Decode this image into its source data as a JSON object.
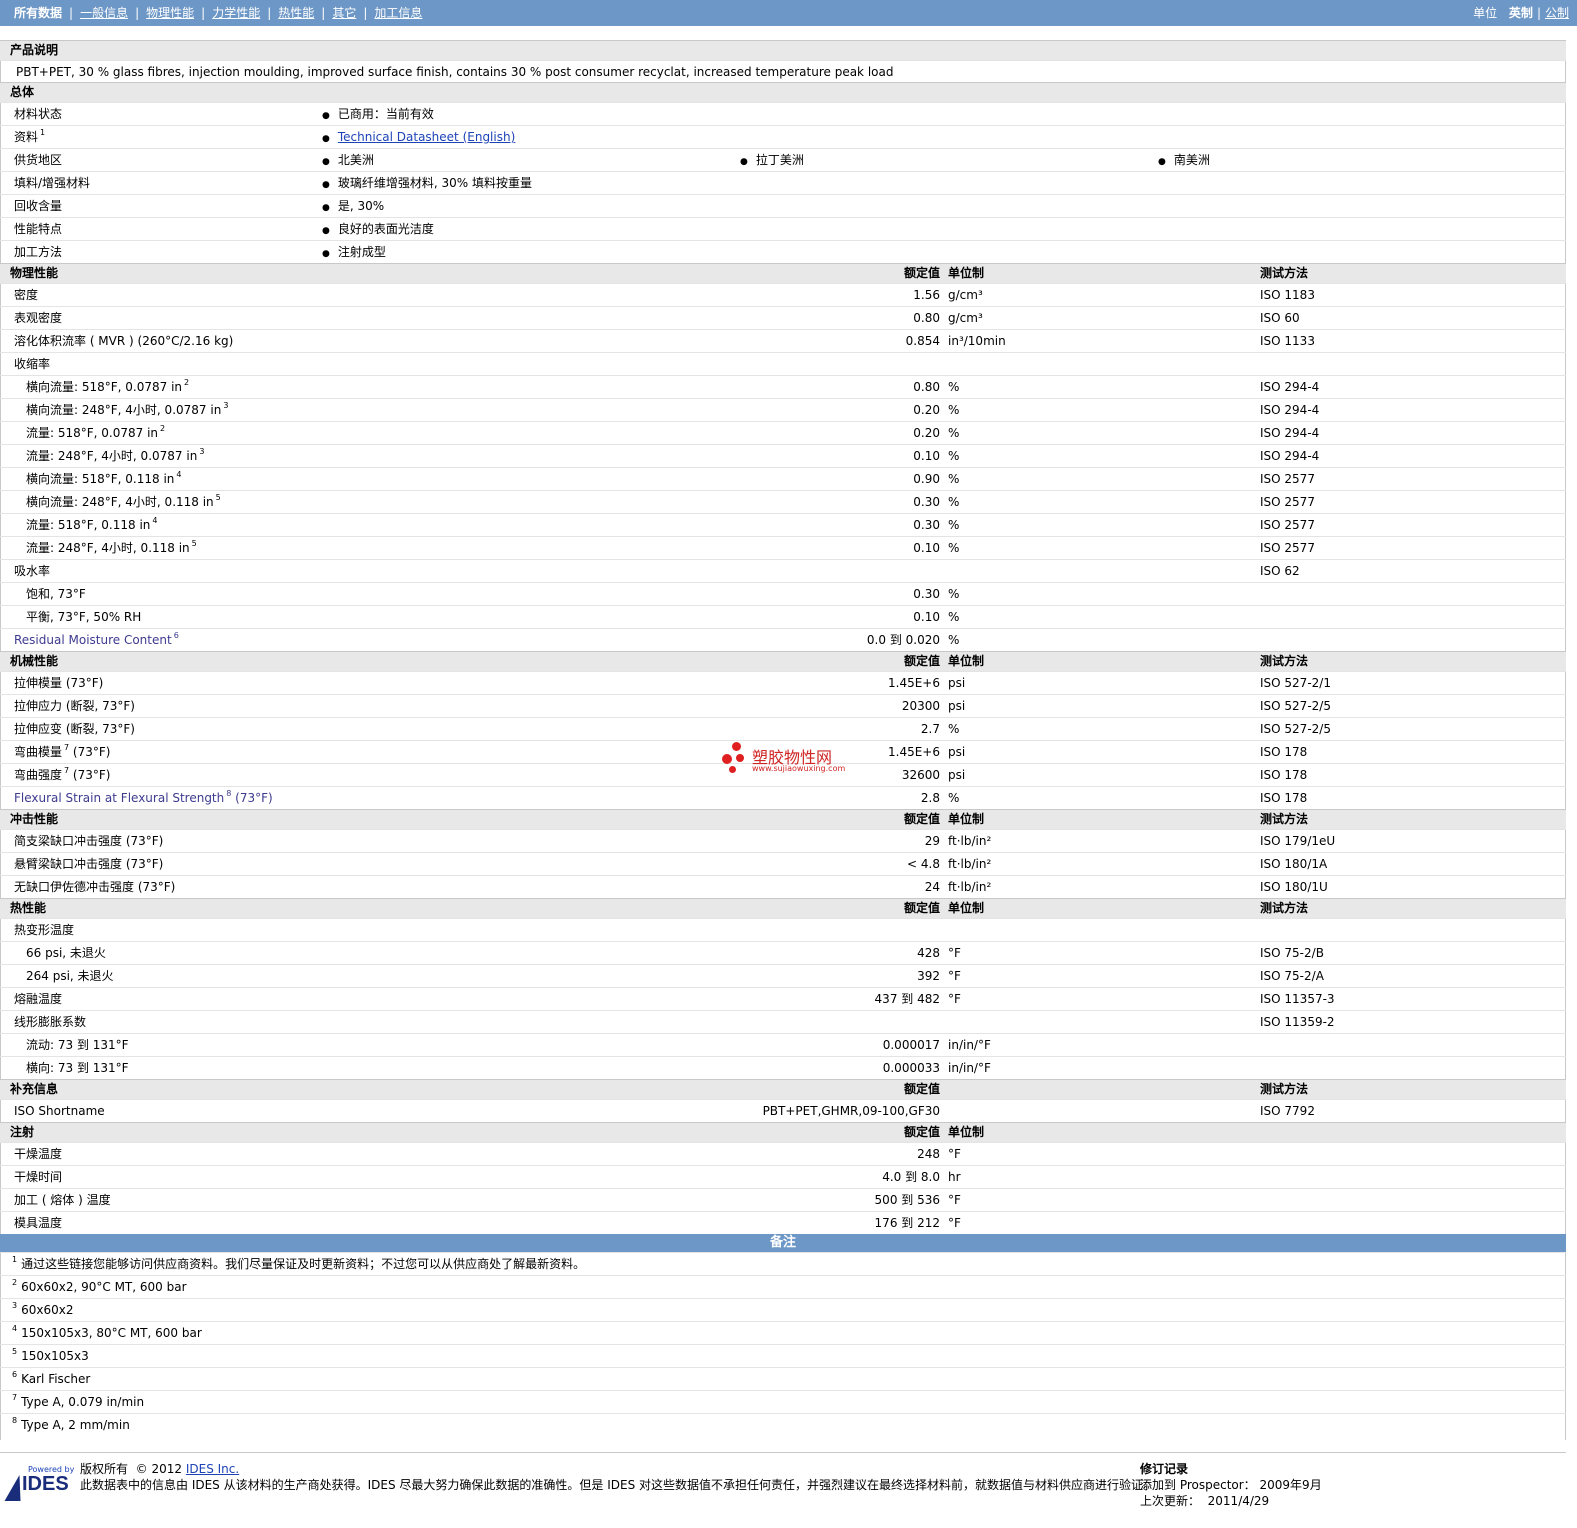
{
  "nav": {
    "all": "所有数据",
    "general": "一般信息",
    "physical": "物理性能",
    "mechanical": "力学性能",
    "thermal": "热性能",
    "other": "其它",
    "processing": "加工信息",
    "units_label": "单位",
    "unit_english": "英制",
    "unit_metric": "公制"
  },
  "desc": {
    "title": "产品说明",
    "text": "PBT+PET, 30 % glass fibres, injection moulding, improved surface finish, contains 30 % post consumer recyclat, increased temperature peak load"
  },
  "general": {
    "title": "总体",
    "status_label": "材料状态",
    "status_value": "已商用：当前有效",
    "docs_label": "资料",
    "docs_sup": "1",
    "docs_link": "Technical Datasheet (English)",
    "region_label": "供货地区",
    "region_1": "北美洲",
    "region_2": "拉丁美洲",
    "region_3": "南美洲",
    "filler_label": "填料/增强材料",
    "filler_value": "玻璃纤维增强材料, 30% 填料按重量",
    "recycle_label": "回收含量",
    "recycle_value": "是, 30%",
    "feature_label": "性能特点",
    "feature_value": "良好的表面光洁度",
    "method_label": "加工方法",
    "method_value": "注射成型"
  },
  "headers": {
    "value": "额定值",
    "unit": "单位制",
    "test": "测试方法"
  },
  "physical": {
    "title": "物理性能",
    "rows": [
      {
        "name": "密度",
        "sup": "",
        "val": "1.56",
        "unit": "g/cm³",
        "test": "ISO 1183"
      },
      {
        "name": "表观密度",
        "sup": "",
        "val": "0.80",
        "unit": "g/cm³",
        "test": "ISO 60"
      },
      {
        "name": "溶化体积流率 ( MVR )  (260°C/2.16 kg)",
        "sup": "",
        "val": "0.854",
        "unit": "in³/10min",
        "test": "ISO 1133"
      },
      {
        "name": "收缩率",
        "sup": "",
        "val": "",
        "unit": "",
        "test": ""
      },
      {
        "name": "横向流量: 518°F, 0.0787 in",
        "sup": "2",
        "val": "0.80",
        "unit": "%",
        "test": "ISO 294-4"
      },
      {
        "name": "横向流量: 248°F, 4小时, 0.0787 in",
        "sup": "3",
        "val": "0.20",
        "unit": "%",
        "test": "ISO 294-4"
      },
      {
        "name": "流量: 518°F, 0.0787 in",
        "sup": "2",
        "val": "0.20",
        "unit": "%",
        "test": "ISO 294-4"
      },
      {
        "name": "流量: 248°F, 4小时, 0.0787 in",
        "sup": "3",
        "val": "0.10",
        "unit": "%",
        "test": "ISO 294-4"
      },
      {
        "name": "横向流量: 518°F, 0.118 in",
        "sup": "4",
        "val": "0.90",
        "unit": "%",
        "test": "ISO 2577"
      },
      {
        "name": "横向流量: 248°F, 4小时, 0.118 in",
        "sup": "5",
        "val": "0.30",
        "unit": "%",
        "test": "ISO 2577"
      },
      {
        "name": "流量: 518°F, 0.118 in",
        "sup": "4",
        "val": "0.30",
        "unit": "%",
        "test": "ISO 2577"
      },
      {
        "name": "流量: 248°F, 4小时, 0.118 in",
        "sup": "5",
        "val": "0.10",
        "unit": "%",
        "test": "ISO 2577"
      },
      {
        "name": "吸水率",
        "sup": "",
        "val": "",
        "unit": "",
        "test": "ISO 62"
      },
      {
        "name": "饱和, 73°F",
        "sup": "",
        "val": "0.30",
        "unit": "%",
        "test": ""
      },
      {
        "name": "平衡, 73°F, 50% RH",
        "sup": "",
        "val": "0.10",
        "unit": "%",
        "test": ""
      },
      {
        "name": "Residual Moisture Content",
        "sup": "6",
        "val": "0.0 到  0.020",
        "unit": "%",
        "test": ""
      }
    ]
  },
  "mechanical": {
    "title": "机械性能",
    "rows": [
      {
        "name": "拉伸模量  (73°F)",
        "sup": "",
        "val": "1.45E+6",
        "unit": "psi",
        "test": "ISO 527-2/1"
      },
      {
        "name": "拉伸应力  (断裂, 73°F)",
        "sup": "",
        "val": "20300",
        "unit": "psi",
        "test": "ISO 527-2/5"
      },
      {
        "name": "拉伸应变  (断裂, 73°F)",
        "sup": "",
        "val": "2.7",
        "unit": "%",
        "test": "ISO 527-2/5"
      },
      {
        "name": "弯曲模量",
        "sup": "7",
        "extra": " (73°F)",
        "val": "1.45E+6",
        "unit": "psi",
        "test": "ISO 178"
      },
      {
        "name": "弯曲强度",
        "sup": "7",
        "extra": " (73°F)",
        "val": "32600",
        "unit": "psi",
        "test": "ISO 178"
      },
      {
        "name": "Flexural Strain at Flexural Strength",
        "sup": "8",
        "extra": " (73°F)",
        "val": "2.8",
        "unit": "%",
        "test": "ISO 178"
      }
    ]
  },
  "impact": {
    "title": "冲击性能",
    "rows": [
      {
        "name": "简支梁缺口冲击强度  (73°F)",
        "val": "29",
        "unit": "ft·lb/in²",
        "test": "ISO 179/1eU"
      },
      {
        "name": "悬臂梁缺口冲击强度  (73°F)",
        "val": "< 4.8",
        "unit": "ft·lb/in²",
        "test": "ISO 180/1A"
      },
      {
        "name": "无缺口伊佐德冲击强度  (73°F)",
        "val": "24",
        "unit": "ft·lb/in²",
        "test": "ISO 180/1U"
      }
    ]
  },
  "thermal": {
    "title": "热性能",
    "rows": [
      {
        "name": "热变形温度",
        "val": "",
        "unit": "",
        "test": ""
      },
      {
        "name": "66 psi, 未退火",
        "val": "428",
        "unit": "°F",
        "test": "ISO 75-2/B"
      },
      {
        "name": "264 psi, 未退火",
        "val": "392",
        "unit": "°F",
        "test": "ISO 75-2/A"
      },
      {
        "name": "熔融温度",
        "val": "437 到  482",
        "unit": "°F",
        "test": "ISO 11357-3"
      },
      {
        "name": "线形膨胀系数",
        "val": "",
        "unit": "",
        "test": "ISO 11359-2"
      },
      {
        "name": "流动: 73 到  131°F",
        "val": "0.000017",
        "unit": "in/in/°F",
        "test": ""
      },
      {
        "name": "横向: 73 到  131°F",
        "val": "0.000033",
        "unit": "in/in/°F",
        "test": ""
      }
    ]
  },
  "supplement": {
    "title": "补充信息",
    "rows": [
      {
        "name": "ISO Shortname",
        "val": "PBT+PET,GHMR,09-100,GF30",
        "unit": "",
        "test": "ISO 7792"
      }
    ]
  },
  "injection": {
    "title": "注射",
    "rows": [
      {
        "name": "干燥温度",
        "val": "248",
        "unit": "°F"
      },
      {
        "name": "干燥时间",
        "val": "4.0 到  8.0",
        "unit": "hr"
      },
      {
        "name": "加工 ( 熔体 ) 温度",
        "val": "500 到  536",
        "unit": "°F"
      },
      {
        "name": "模具温度",
        "val": "176 到  212",
        "unit": "°F"
      }
    ]
  },
  "notes": {
    "title": "备注",
    "items": [
      {
        "n": "1",
        "text": "通过这些链接您能够访问供应商资料。我们尽量保证及时更新资料；不过您可以从供应商处了解最新资料。"
      },
      {
        "n": "2",
        "text": "60x60x2, 90°C MT, 600 bar"
      },
      {
        "n": "3",
        "text": "60x60x2"
      },
      {
        "n": "4",
        "text": "150x105x3, 80°C MT, 600 bar"
      },
      {
        "n": "5",
        "text": "150x105x3"
      },
      {
        "n": "6",
        "text": "Karl Fischer"
      },
      {
        "n": "7",
        "text": "Type A, 0.079 in/min"
      },
      {
        "n": "8",
        "text": "Type A, 2 mm/min"
      }
    ]
  },
  "watermark": {
    "text": "塑胶物性网",
    "url": "www.sujiaowuxing.com"
  },
  "footer": {
    "logo_powered": "Powered by",
    "logo_text": "IDES",
    "copyright_label": "版权所有",
    "copyright_year": "© 2012",
    "company_link": "IDES Inc.",
    "disclaimer": "此数据表中的信息由  IDES 从该材料的生产商处获得。IDES 尽最大努力确保此数据的准确性。但是  IDES 对这些数据值不承担任何责任，并强烈建议在最终选择材料前，就数据值与材料供应商进行验证。",
    "rev_title": "修订记录",
    "added_label": "添加到  Prospector：",
    "added_value": "2009年9月",
    "updated_label": "上次更新：",
    "updated_value": "2011/4/29"
  }
}
